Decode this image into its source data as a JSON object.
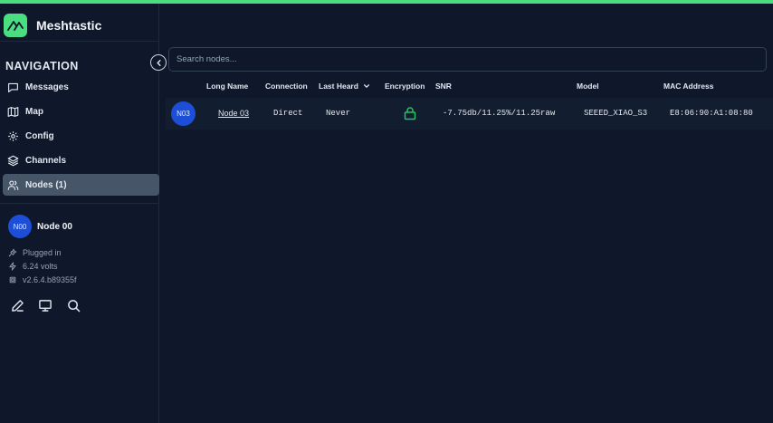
{
  "app": {
    "name": "Meshtastic",
    "accent": "#4ade80"
  },
  "sidebar": {
    "heading": "NAVIGATION",
    "items": [
      {
        "label": "Messages",
        "icon": "message-icon"
      },
      {
        "label": "Map",
        "icon": "map-icon"
      },
      {
        "label": "Config",
        "icon": "gear-icon"
      },
      {
        "label": "Channels",
        "icon": "layers-icon"
      },
      {
        "label": "Nodes (1)",
        "icon": "users-icon",
        "active": true
      }
    ],
    "node": {
      "short": "N00",
      "name": "Node 00"
    },
    "status": {
      "power": "Plugged in",
      "voltage": "6.24 volts",
      "firmware": "v2.6.4.b89355f"
    },
    "tools": [
      "pen-icon",
      "monitor-icon",
      "search-icon"
    ]
  },
  "search": {
    "placeholder": "Search nodes..."
  },
  "table": {
    "headers": {
      "long_name": "Long Name",
      "connection": "Connection",
      "last_heard": "Last Heard",
      "encryption": "Encryption",
      "snr": "SNR",
      "model": "Model",
      "mac": "MAC Address"
    },
    "rows": [
      {
        "short": "N03",
        "long_name": "Node 03",
        "connection": "Direct",
        "last_heard": "Never",
        "encryption": "lock-icon",
        "snr": "-7.75db/11.25%/11.25raw",
        "model": "SEEED_XIAO_S3",
        "mac": "E8:06:90:A1:08:80"
      }
    ]
  }
}
